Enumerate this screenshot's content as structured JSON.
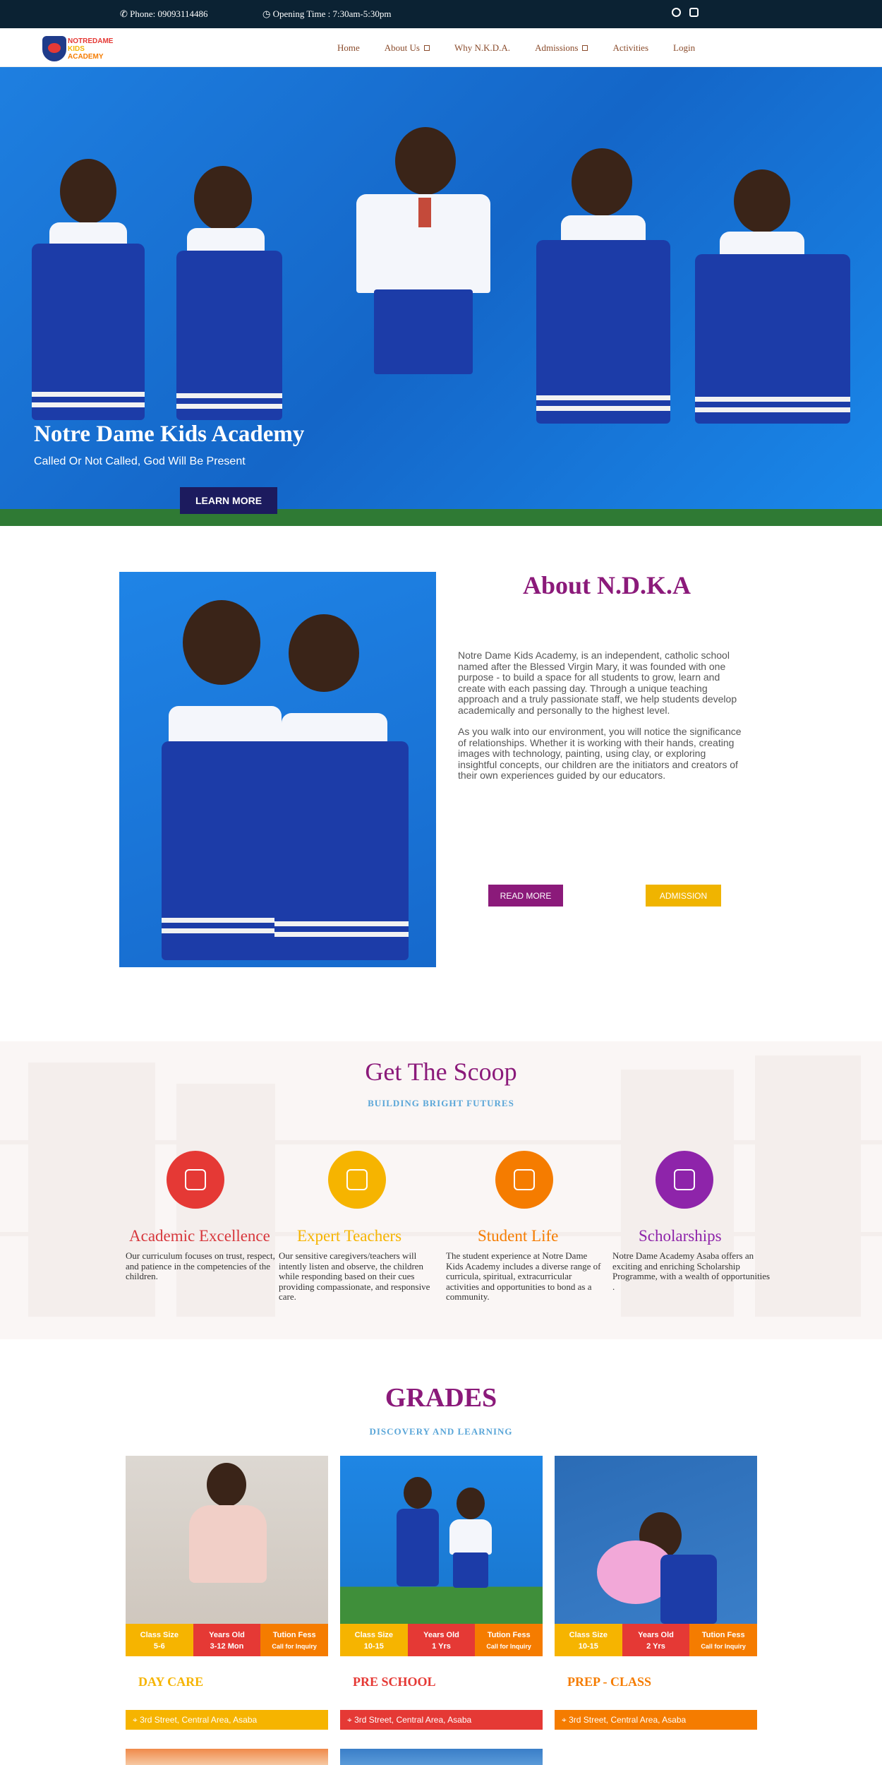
{
  "topbar": {
    "phone": "Phone: 09093114486",
    "hours": "Opening Time : 7:30am-5:30pm",
    "social": [
      "facebook-icon",
      "instagram-icon"
    ]
  },
  "nav": {
    "logo": {
      "line1": "NOTREDAME",
      "line2": "KIDS",
      "line3": "ACADEMY"
    },
    "items": [
      {
        "label": "Home"
      },
      {
        "label": "About Us",
        "dropdown": true
      },
      {
        "label": "Why N.K.D.A."
      },
      {
        "label": "Admissions",
        "dropdown": true
      },
      {
        "label": "Activities"
      },
      {
        "label": "Login"
      }
    ]
  },
  "hero": {
    "title": "Notre Dame Kids Academy",
    "subtitle": "Called Or Not Called, God Will Be Present",
    "button": "LEARN MORE"
  },
  "about": {
    "title": "About N.D.K.A",
    "paragraphs": [
      "Notre Dame Kids Academy, is an independent, catholic school named after the Blessed Virgin Mary, it was founded with one purpose - to build a space for all students to grow, learn and create with each passing day. Through a unique teaching approach and a truly passionate staff, we help students develop academically and personally to the highest level.",
      "As you walk into our environment, you will notice the significance of relationships. Whether it is working with their hands, creating images with technology, painting, using clay, or exploring insightful concepts, our children are the initiators and creators of their own experiences guided by our educators."
    ],
    "read_more": "READ MORE",
    "admission": "ADMISSION"
  },
  "scoop": {
    "title": "Get The Scoop",
    "subtitle": "BUILDING BRIGHT FUTURES",
    "features": [
      {
        "title": "Academic Excellence",
        "color": "#e53935",
        "title_color": "#d7373c",
        "icon": "abc-blocks-icon",
        "text": "Our curriculum focuses on trust, respect, and patience in the competencies of the children."
      },
      {
        "title": "Expert Teachers",
        "color": "#f6b400",
        "title_color": "#f6b400",
        "icon": "teacher-icon",
        "text": "Our sensitive caregivers/teachers will intently listen and observe, the children while responding based on their cues providing compassionate, and responsive care."
      },
      {
        "title": "Student Life",
        "color": "#f57c00",
        "title_color": "#f57c00",
        "icon": "flower-icon",
        "text": "The student experience at Notre Dame Kids Academy includes a diverse range of curricula, spiritual, extracurricular activities and opportunities to bond as a community."
      },
      {
        "title": "Scholarships",
        "color": "#8e24aa",
        "title_color": "#8e24aa",
        "icon": "cube-icon",
        "text": "Notre Dame Academy Asaba offers an exciting and enriching Scholarship Programme, with a wealth of opportunities ."
      }
    ]
  },
  "grades": {
    "title": "GRADES",
    "subtitle": "DISCOVERY AND LEARNING",
    "cards": [
      {
        "name": "DAY CARE",
        "name_color": "#f6b400",
        "addr_color": "#f6b400",
        "size": "5-6",
        "age": "3-12 Mon",
        "fees": "Call for Inquiry",
        "address": "3rd Street, Central Area, Asaba"
      },
      {
        "name": "PRE SCHOOL",
        "name_color": "#e53935",
        "addr_color": "#e53935",
        "size": "10-15",
        "age": "1 Yrs",
        "fees": "Call for Inquiry",
        "address": "3rd Street, Central Area, Asaba"
      },
      {
        "name": "PREP - CLASS",
        "name_color": "#f57c00",
        "addr_color": "#f57c00",
        "size": "10-15",
        "age": "2 Yrs",
        "fees": "Call for Inquiry",
        "address": "3rd Street, Central Area, Asaba"
      }
    ],
    "labels": {
      "size": "Class Size",
      "age": "Years Old",
      "fees": "Tution Fess"
    }
  },
  "colors": {
    "purple": "#8b1a7a",
    "navy": "#0b2233",
    "blue": "#5aa6d8",
    "yellow": "#f6b400",
    "red": "#e53935",
    "orange": "#f57c00"
  }
}
